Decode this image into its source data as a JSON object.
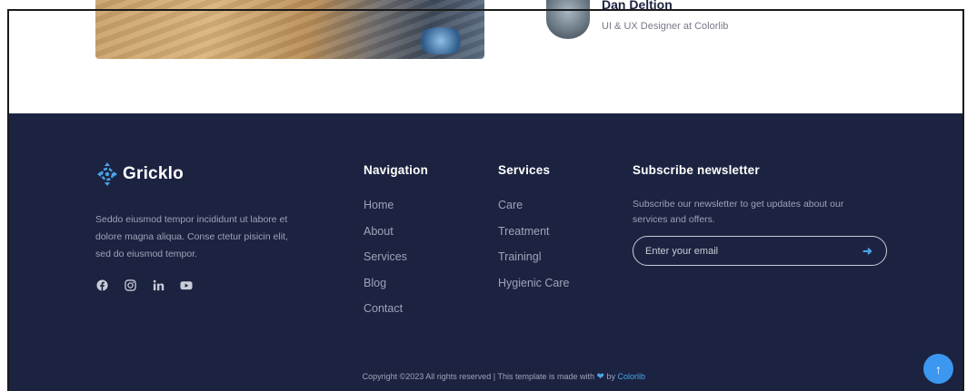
{
  "blog": {
    "author_name": "Dan Deltion",
    "author_role": "UI & UX Designer at Colorlib"
  },
  "footer": {
    "logo_text": "Gricklo",
    "about_text": "Seddo eiusmod tempor incididunt ut labore et dolore magna aliqua. Conse ctetur pisicin elit, sed do eiusmod tempor.",
    "socials": [
      {
        "icon": "facebook-icon"
      },
      {
        "icon": "instagram-icon"
      },
      {
        "icon": "linkedin-icon"
      },
      {
        "icon": "youtube-icon"
      }
    ],
    "navigation": {
      "title": "Navigation",
      "items": [
        "Home",
        "About",
        "Services",
        "Blog",
        "Contact"
      ]
    },
    "services": {
      "title": "Services",
      "items": [
        "Care",
        "Treatment",
        "Trainingl",
        "Hygienic Care"
      ]
    },
    "newsletter": {
      "title": "Subscribe newsletter",
      "text": "Subscribe our newsletter to get updates about our services and offers.",
      "placeholder": "Enter your email",
      "submit_icon": "arrow-right-icon"
    },
    "copyright": {
      "prefix": "Copyright ©2023 All rights reserved | This template is made with",
      "by": "by",
      "brand": "Colorlib"
    },
    "back_to_top_icon": "arrow-up-icon"
  },
  "colors": {
    "footer_bg": "#1c2340",
    "accent": "#3b97f0",
    "link": "#4aa3e8"
  }
}
